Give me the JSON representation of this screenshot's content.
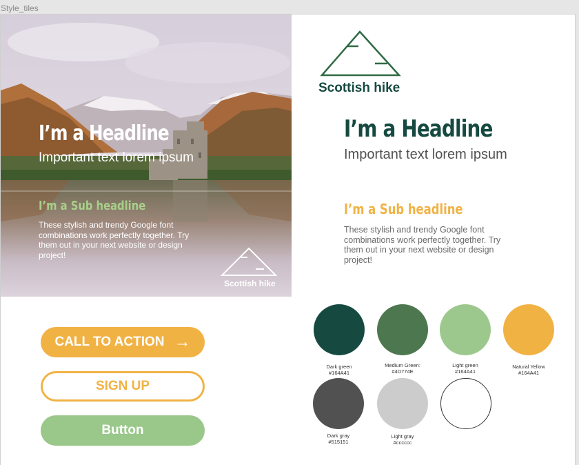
{
  "frame": {
    "title": "Style_tiles"
  },
  "hero": {
    "headline": "I’m  a Headline",
    "important": "Important text lorem ipsum",
    "subhead": "I’m  a Sub headline",
    "body": "These stylish and trendy Google font combinations work perfectly together. Try them out in your next website or design project!",
    "brand": "Scottish hike"
  },
  "logo": {
    "brand": "Scottish hike"
  },
  "content": {
    "headline": "I’m  a Headline",
    "important": "Important text lorem ipsum",
    "subhead": "I’m  a Sub headline",
    "body": "These stylish and trendy Google font combinations work perfectly together. Try them out in your next website or design project!"
  },
  "buttons": {
    "cta": "CALL TO ACTION",
    "cta_arrow": "→",
    "signup": "SIGN UP",
    "button": "Button"
  },
  "palette": [
    {
      "name": "Dark green",
      "code": "#164A41",
      "color": "#164a41"
    },
    {
      "name": "Medium Green:",
      "code": "#4D774E",
      "color": "#4d774e"
    },
    {
      "name": "Light green",
      "code": "#164A41",
      "color": "#9dc88d"
    },
    {
      "name": "Natural Yellow",
      "code": "#164A41",
      "color": "#f1b244"
    },
    {
      "name": "Dark gray",
      "code": "#515151",
      "color": "#515151"
    },
    {
      "name": "Light gray",
      "code": "#cccccc",
      "color": "#cccccc"
    },
    {
      "name": "",
      "code": "",
      "color": "#ffffff"
    }
  ],
  "colors": {
    "dark_green": "#164a41",
    "yellow": "#f1b244",
    "light_green": "#9ac78a"
  }
}
